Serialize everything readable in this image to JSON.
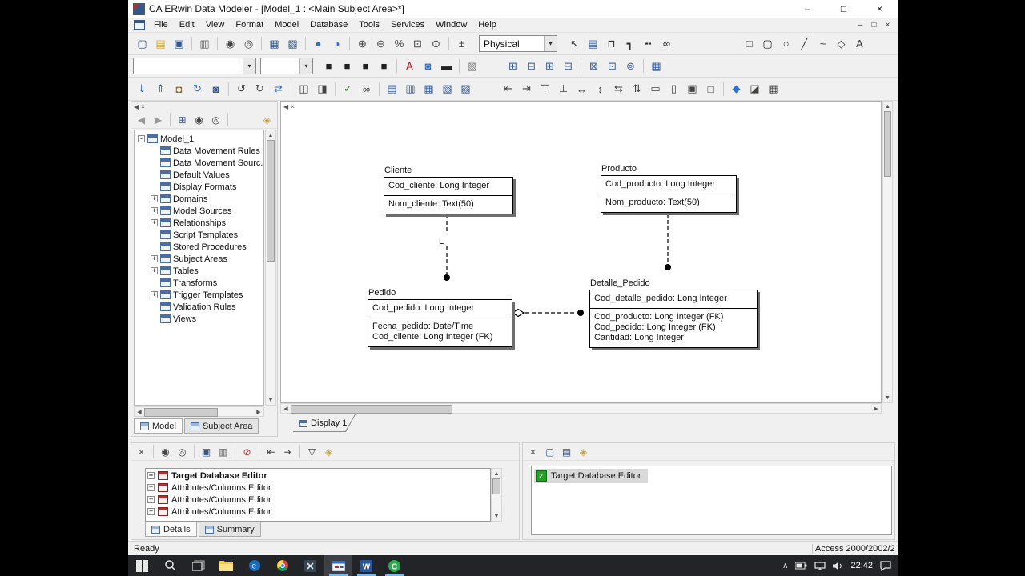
{
  "window": {
    "title": "CA ERwin Data Modeler - [Model_1 : <Main Subject Area>*]",
    "controls": {
      "minimize": "–",
      "maximize": "□",
      "close": "×"
    }
  },
  "menubar": {
    "items": [
      "File",
      "Edit",
      "View",
      "Format",
      "Model",
      "Database",
      "Tools",
      "Services",
      "Window",
      "Help"
    ],
    "mdi_controls": {
      "minimize": "–",
      "restore": "□",
      "close": "×"
    }
  },
  "toolbar_main": {
    "file_icons": [
      {
        "n": "new-model-icon",
        "g": "▢",
        "c": "#35578d"
      },
      {
        "n": "open-model-icon",
        "g": "▤",
        "c": "#caa53c"
      },
      {
        "n": "save-model-icon",
        "g": "▣",
        "c": "#35578d"
      },
      {
        "n": "separator"
      },
      {
        "n": "print-icon",
        "g": "▥",
        "c": "#666666"
      },
      {
        "n": "separator"
      },
      {
        "n": "find-icon",
        "g": "◉",
        "c": "#444444"
      },
      {
        "n": "find-entity-icon",
        "g": "◎",
        "c": "#444444"
      },
      {
        "n": "separator"
      },
      {
        "n": "report-template-builder-icon",
        "g": "▦",
        "c": "#35578d"
      },
      {
        "n": "query-tool-icon",
        "g": "▧",
        "c": "#35578d"
      },
      {
        "n": "separator"
      },
      {
        "n": "complete-compare-icon",
        "g": "●",
        "c": "#2e6fd0"
      },
      {
        "n": "model-sync-icon",
        "g": "◑",
        "c": "#2e6fd0"
      },
      {
        "n": "separator"
      },
      {
        "n": "zoom-in-icon",
        "g": "⊕",
        "c": "#444444"
      },
      {
        "n": "zoom-out-icon",
        "g": "⊖",
        "c": "#444444"
      },
      {
        "n": "zoom-percent-icon",
        "g": "%",
        "c": "#444444"
      },
      {
        "n": "zoom-fit-icon",
        "g": "⊡",
        "c": "#444444"
      },
      {
        "n": "zoom-region-icon",
        "g": "⊙",
        "c": "#444444"
      },
      {
        "n": "separator"
      },
      {
        "n": "print-scale-icon",
        "g": "±",
        "c": "#444444"
      }
    ],
    "target_model": {
      "value": "Physical"
    },
    "draw_icons": [
      {
        "n": "select-tool-icon",
        "g": "↖",
        "c": "#333333"
      },
      {
        "n": "entity-tool-icon",
        "g": "▤",
        "c": "#35578d"
      },
      {
        "n": "category-tool-icon",
        "g": "⊓",
        "c": "#333333"
      },
      {
        "n": "identifying-relationship-tool-icon",
        "g": "┓",
        "c": "#333333"
      },
      {
        "n": "nonidentifying-relationship-tool-icon",
        "g": "╍",
        "c": "#333333"
      },
      {
        "n": "many-to-many-tool-icon",
        "g": "∞",
        "c": "#333333"
      }
    ],
    "shape_icons": [
      {
        "n": "rectangle-tool-icon",
        "g": "□",
        "c": "#333333"
      },
      {
        "n": "rounded-rectangle-tool-icon",
        "g": "▢",
        "c": "#333333"
      },
      {
        "n": "ellipse-tool-icon",
        "g": "○",
        "c": "#333333"
      },
      {
        "n": "line-tool-icon",
        "g": "╱",
        "c": "#333333"
      },
      {
        "n": "freeform-tool-icon",
        "g": "~",
        "c": "#333333"
      },
      {
        "n": "diamond-tool-icon",
        "g": "◇",
        "c": "#333333"
      },
      {
        "n": "text-block-tool-icon",
        "g": "A",
        "c": "#333333"
      }
    ]
  },
  "toolbar_format": {
    "font_combo_value": "",
    "size_combo_value": "",
    "format_icons": [
      {
        "n": "bold-icon",
        "g": "■",
        "c": "#222222"
      },
      {
        "n": "italic-icon",
        "g": "■",
        "c": "#222222"
      },
      {
        "n": "underline-icon",
        "g": "■",
        "c": "#222222"
      },
      {
        "n": "shadow-icon",
        "g": "■",
        "c": "#222222"
      },
      {
        "n": "separator"
      },
      {
        "n": "font-color-icon",
        "g": "A",
        "c": "#b02020"
      },
      {
        "n": "fill-color-icon",
        "g": "◙",
        "c": "#2e6fd0"
      },
      {
        "n": "line-color-icon",
        "g": "▬",
        "c": "#222222"
      },
      {
        "n": "separator"
      },
      {
        "n": "format-painter-icon",
        "g": "▧",
        "c": "#777777"
      }
    ],
    "db_icons": [
      {
        "n": "add-table-icon",
        "g": "⊞",
        "c": "#35578d"
      },
      {
        "n": "delete-table-icon",
        "g": "⊟",
        "c": "#35578d"
      },
      {
        "n": "add-column-icon",
        "g": "⊞",
        "c": "#35578d"
      },
      {
        "n": "delete-column-icon",
        "g": "⊟",
        "c": "#35578d"
      },
      {
        "n": "separator"
      },
      {
        "n": "index-editor-icon",
        "g": "⊠",
        "c": "#35578d"
      },
      {
        "n": "view-editor-icon",
        "g": "⊡",
        "c": "#35578d"
      },
      {
        "n": "trigger-editor-icon",
        "g": "⊚",
        "c": "#35578d"
      },
      {
        "n": "separator"
      },
      {
        "n": "domain-editor-icon",
        "g": "▦",
        "c": "#35578d"
      }
    ]
  },
  "toolbar_tools": {
    "model_icons": [
      {
        "n": "mart-open-icon",
        "g": "⇓",
        "c": "#35578d"
      },
      {
        "n": "mart-save-icon",
        "g": "⇑",
        "c": "#35578d"
      },
      {
        "n": "mart-lock-icon",
        "g": "◘",
        "c": "#8a6d2a"
      },
      {
        "n": "mart-refresh-icon",
        "g": "↻",
        "c": "#2e6fd0"
      },
      {
        "n": "mart-admin-icon",
        "g": "◙",
        "c": "#35578d"
      },
      {
        "n": "separator"
      },
      {
        "n": "undo-icon",
        "g": "↺",
        "c": "#444444"
      },
      {
        "n": "redo-icon",
        "g": "↻",
        "c": "#444444"
      },
      {
        "n": "refresh-icon",
        "g": "⇄",
        "c": "#2e6fd0"
      },
      {
        "n": "separator"
      },
      {
        "n": "model-merge-icon",
        "g": "◫",
        "c": "#444444"
      },
      {
        "n": "model-compare-icon",
        "g": "◨",
        "c": "#444444"
      },
      {
        "n": "separator"
      },
      {
        "n": "spell-check-icon",
        "g": "✓",
        "c": "#2a7a2a"
      },
      {
        "n": "overview-icon",
        "g": "∞",
        "c": "#333333"
      },
      {
        "n": "separator"
      },
      {
        "n": "display-entity-level-icon",
        "g": "▤",
        "c": "#35578d"
      },
      {
        "n": "display-attribute-level-icon",
        "g": "▥",
        "c": "#35578d"
      },
      {
        "n": "display-pk-level-icon",
        "g": "▦",
        "c": "#35578d"
      },
      {
        "n": "display-definition-icon",
        "g": "▧",
        "c": "#35578d"
      },
      {
        "n": "display-icon-level-icon",
        "g": "▨",
        "c": "#35578d"
      }
    ],
    "align_icons": [
      {
        "n": "align-left-icon",
        "g": "⇤",
        "c": "#444444"
      },
      {
        "n": "align-right-icon",
        "g": "⇥",
        "c": "#444444"
      },
      {
        "n": "align-top-icon",
        "g": "⊤",
        "c": "#444444"
      },
      {
        "n": "align-bottom-icon",
        "g": "⊥",
        "c": "#444444"
      },
      {
        "n": "center-horizontal-icon",
        "g": "↔",
        "c": "#444444"
      },
      {
        "n": "center-vertical-icon",
        "g": "↕",
        "c": "#444444"
      },
      {
        "n": "distribute-horizontal-icon",
        "g": "⇆",
        "c": "#444444"
      },
      {
        "n": "distribute-vertical-icon",
        "g": "⇅",
        "c": "#444444"
      },
      {
        "n": "same-width-icon",
        "g": "▭",
        "c": "#444444"
      },
      {
        "n": "same-height-icon",
        "g": "▯",
        "c": "#444444"
      },
      {
        "n": "group-icon",
        "g": "▣",
        "c": "#444444"
      },
      {
        "n": "ungroup-icon",
        "g": "□",
        "c": "#444444"
      },
      {
        "n": "separator"
      },
      {
        "n": "layout-diamond-icon",
        "g": "◆",
        "c": "#2e6fd0"
      },
      {
        "n": "layer-icon",
        "g": "◪",
        "c": "#444444"
      },
      {
        "n": "grid-icon",
        "g": "▦",
        "c": "#444444"
      }
    ]
  },
  "model_explorer": {
    "toolbar_icons": [
      {
        "n": "back-icon",
        "g": "◀",
        "c": "#999999"
      },
      {
        "n": "forward-icon",
        "g": "▶",
        "c": "#999999"
      },
      {
        "n": "separator"
      },
      {
        "n": "expand-all-icon",
        "g": "⊞",
        "c": "#35578d"
      },
      {
        "n": "find-icon",
        "g": "◉",
        "c": "#444444"
      },
      {
        "n": "locate-icon",
        "g": "◎",
        "c": "#444444"
      },
      {
        "n": "separator"
      },
      {
        "n": "properties-icon",
        "g": "◈",
        "c": "#caa53c"
      }
    ],
    "tree": {
      "items": [
        {
          "label": "Model_1",
          "exp": "-",
          "depth": 0
        },
        {
          "label": "Data Movement Rules",
          "exp": "",
          "depth": 1
        },
        {
          "label": "Data Movement Sourc...",
          "exp": "",
          "depth": 1
        },
        {
          "label": "Default Values",
          "exp": "",
          "depth": 1
        },
        {
          "label": "Display Formats",
          "exp": "",
          "depth": 1
        },
        {
          "label": "Domains",
          "exp": "+",
          "depth": 1
        },
        {
          "label": "Model Sources",
          "exp": "+",
          "depth": 1
        },
        {
          "label": "Relationships",
          "exp": "+",
          "depth": 1
        },
        {
          "label": "Script Templates",
          "exp": "",
          "depth": 1
        },
        {
          "label": "Stored Procedures",
          "exp": "",
          "depth": 1
        },
        {
          "label": "Subject Areas",
          "exp": "+",
          "depth": 1
        },
        {
          "label": "Tables",
          "exp": "+",
          "depth": 1
        },
        {
          "label": "Transforms",
          "exp": "",
          "depth": 1
        },
        {
          "label": "Trigger Templates",
          "exp": "+",
          "depth": 1
        },
        {
          "label": "Validation Rules",
          "exp": "",
          "depth": 1
        },
        {
          "label": "Views",
          "exp": "",
          "depth": 1
        }
      ]
    },
    "tabs": [
      {
        "label": "Model",
        "active": true
      },
      {
        "label": "Subject Area",
        "active": false
      }
    ]
  },
  "diagram": {
    "tab": "Display 1",
    "entities": [
      {
        "name": "Cliente",
        "pk": [
          "Cod_cliente: Long Integer"
        ],
        "attributes": [
          "Nom_cliente: Text(50)"
        ]
      },
      {
        "name": "Producto",
        "pk": [
          "Cod_producto: Long Integer"
        ],
        "attributes": [
          "Nom_producto: Text(50)"
        ]
      },
      {
        "name": "Pedido",
        "pk": [
          "Cod_pedido: Long Integer"
        ],
        "attributes": [
          "Fecha_pedido: Date/Time",
          "Cod_cliente: Long Integer (FK)"
        ]
      },
      {
        "name": "Detalle_Pedido",
        "pk": [
          "Cod_detalle_pedido: Long Integer"
        ],
        "attributes": [
          "Cod_producto: Long Integer (FK)",
          "Cod_pedido: Long Integer (FK)",
          "Cantidad: Long Integer"
        ]
      }
    ],
    "relationships": [
      {
        "from": "Cliente",
        "to": "Pedido",
        "label": "L"
      },
      {
        "from": "Producto",
        "to": "Detalle_Pedido",
        "label": ""
      },
      {
        "from": "Pedido",
        "to": "Detalle_Pedido",
        "label": ""
      }
    ]
  },
  "action_log": {
    "toolbar_icons": [
      {
        "n": "close-panel-icon",
        "g": "×",
        "c": "#444444"
      },
      {
        "n": "separator"
      },
      {
        "n": "find-icon",
        "g": "◉",
        "c": "#444444"
      },
      {
        "n": "find-next-icon",
        "g": "◎",
        "c": "#444444"
      },
      {
        "n": "separator"
      },
      {
        "n": "save-log-icon",
        "g": "▣",
        "c": "#35578d"
      },
      {
        "n": "print-log-icon",
        "g": "▥",
        "c": "#666666"
      },
      {
        "n": "separator"
      },
      {
        "n": "clear-log-icon",
        "g": "⊘",
        "c": "#b03030"
      },
      {
        "n": "separator"
      },
      {
        "n": "first-item-icon",
        "g": "⇤",
        "c": "#444444"
      },
      {
        "n": "last-item-icon",
        "g": "⇥",
        "c": "#444444"
      },
      {
        "n": "separator"
      },
      {
        "n": "filter-icon",
        "g": "▽",
        "c": "#444444"
      },
      {
        "n": "properties-icon",
        "g": "◈",
        "c": "#caa53c"
      }
    ],
    "items": [
      {
        "label": "Target Database Editor",
        "bold": true
      },
      {
        "label": "Attributes/Columns Editor",
        "bold": false
      },
      {
        "label": "Attributes/Columns Editor",
        "bold": false
      },
      {
        "label": "Attributes/Columns Editor",
        "bold": false
      }
    ],
    "tabs": [
      {
        "label": "Details",
        "active": true
      },
      {
        "label": "Summary",
        "active": false
      }
    ]
  },
  "editor_panel": {
    "toolbar_icons": [
      {
        "n": "close-panel-icon",
        "g": "×",
        "c": "#444444"
      },
      {
        "n": "new-editor-icon",
        "g": "▢",
        "c": "#35578d"
      },
      {
        "n": "editors-icon",
        "g": "▤",
        "c": "#35578d"
      },
      {
        "n": "properties-icon",
        "g": "◈",
        "c": "#caa53c"
      }
    ],
    "items": [
      {
        "label": "Target Database Editor"
      }
    ]
  },
  "statusbar": {
    "left": "Ready",
    "right": "Access 2000/2002/2"
  },
  "taskbar": {
    "time": "22:42"
  }
}
